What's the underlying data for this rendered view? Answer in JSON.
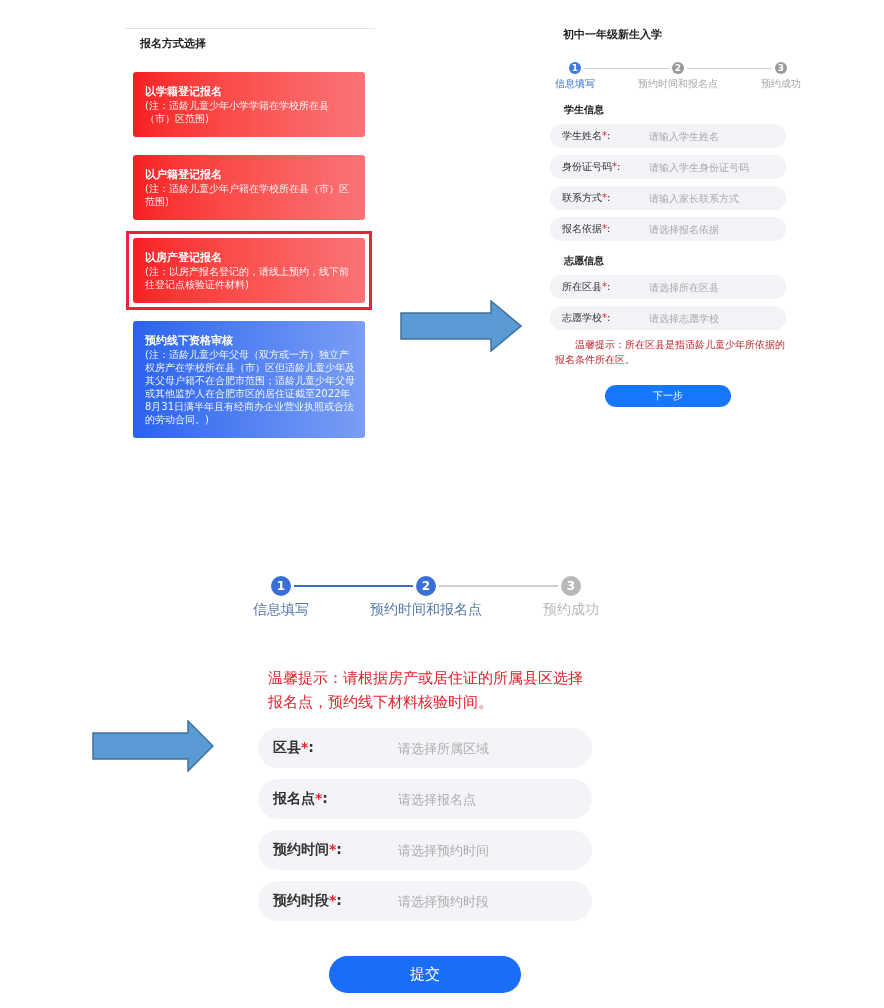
{
  "registration_method_screen": {
    "title": "报名方式选择",
    "cards": [
      {
        "title": "以学籍登记报名",
        "note": "(注：适龄儿童少年小学学籍在学校所在县（市）区范围)",
        "color": "#f81d22",
        "selected": false
      },
      {
        "title": "以户籍登记报名",
        "note": "(注：适龄儿童少年户籍在学校所在县（市）区范围)",
        "color": "#f81d22",
        "selected": false
      },
      {
        "title": "以房产登记报名",
        "note": "(注：以房产报名登记的，请线上预约，线下前往登记点核验证件材料)",
        "color": "#f81d22",
        "selected": true
      },
      {
        "title": "预约线下资格审核",
        "note": "(注：适龄儿童少年父母（双方或一方）独立产权房产在学校所在县（市）区但适龄儿童少年及其父母户籍不在合肥市范围；适龄儿童少年父母或其他监护人在合肥市区的居住证截至2022年8月31日满半年且有经商办企业营业执照或合法的劳动合同。)",
        "color": "#2a62ee",
        "selected": false
      }
    ]
  },
  "student_info_screen": {
    "title": "初中一年级新生入学",
    "stepper": [
      {
        "number": "1",
        "label": "信息填写",
        "active": true
      },
      {
        "number": "2",
        "label": "预约时间和报名点",
        "active": false
      },
      {
        "number": "3",
        "label": "预约成功",
        "active": false
      }
    ],
    "sections": [
      {
        "heading": "学生信息",
        "fields": [
          {
            "label": "学生姓名",
            "required_mark": "*",
            "suffix": ":",
            "placeholder": "请输入学生姓名"
          },
          {
            "label": "身份证号码",
            "required_mark": "*",
            "suffix": ":",
            "placeholder": "请输入学生身份证号码"
          },
          {
            "label": "联系方式",
            "required_mark": "*",
            "suffix": ":",
            "placeholder": "请输入家长联系方式"
          },
          {
            "label": "报名依据",
            "required_mark": "*",
            "suffix": ":",
            "placeholder": "请选择报名依据"
          }
        ]
      },
      {
        "heading": "志愿信息",
        "fields": [
          {
            "label": "所在区县",
            "required_mark": "*",
            "suffix": ":",
            "placeholder": "请选择所在区县"
          },
          {
            "label": "志愿学校",
            "required_mark": "*",
            "suffix": ":",
            "placeholder": "请选择志愿学校"
          }
        ]
      }
    ],
    "tip": "温馨提示：所在区县是指适龄儿童少年所依据的报名条件所在区。",
    "next_button": "下一步"
  },
  "appointment_screen": {
    "stepper": [
      {
        "number": "1",
        "label": "信息填写",
        "active": true
      },
      {
        "number": "2",
        "label": "预约时间和报名点",
        "active": true
      },
      {
        "number": "3",
        "label": "预约成功",
        "active": false
      }
    ],
    "tip": "温馨提示：请根据房产或居住证的所属县区选择报名点，预约线下材料核验时间。",
    "fields": [
      {
        "label": "区县",
        "required_mark": "*",
        "suffix": ":",
        "placeholder": "请选择所属区域"
      },
      {
        "label": "报名点",
        "required_mark": "*",
        "suffix": ":",
        "placeholder": "请选择报名点"
      },
      {
        "label": "预约时间",
        "required_mark": "*",
        "suffix": ":",
        "placeholder": "请选择预约时间"
      },
      {
        "label": "预约时段",
        "required_mark": "*",
        "suffix": ":",
        "placeholder": "请选择预约时段"
      }
    ],
    "submit_button": "提交"
  }
}
